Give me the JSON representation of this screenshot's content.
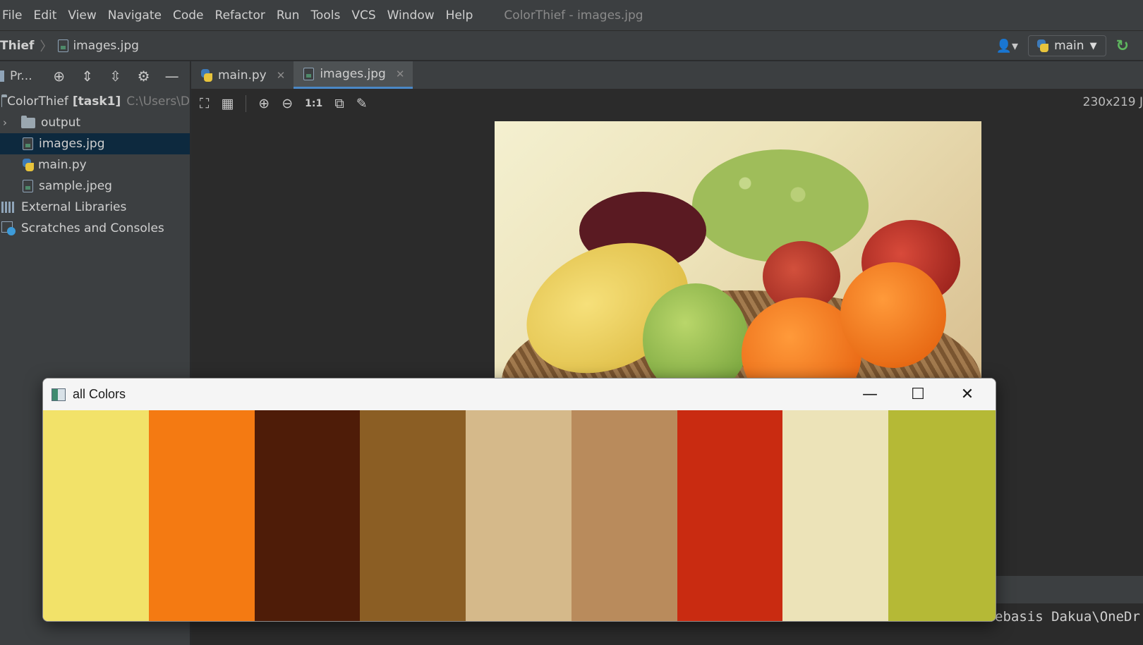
{
  "menu": {
    "items": [
      "File",
      "Edit",
      "View",
      "Navigate",
      "Code",
      "Refactor",
      "Run",
      "Tools",
      "VCS",
      "Window",
      "Help"
    ],
    "window_title": "ColorThief - images.jpg"
  },
  "navbar": {
    "project": "Thief",
    "file": "images.jpg",
    "run_config": "main"
  },
  "project_panel": {
    "title": "Pr...",
    "tree": [
      {
        "label": "ColorThief",
        "bold": "[task1]",
        "path": "C:\\Users\\D"
      },
      {
        "label": "output"
      },
      {
        "label": "images.jpg"
      },
      {
        "label": "main.py"
      },
      {
        "label": "sample.jpeg"
      },
      {
        "label": "External Libraries"
      },
      {
        "label": "Scratches and Consoles"
      }
    ]
  },
  "editor": {
    "tabs": [
      {
        "label": "main.py"
      },
      {
        "label": "images.jpg"
      }
    ],
    "image_info": "230x219 J",
    "zoom_actual_label": "1:1",
    "console_text": "ebasis Dakua\\OneDr"
  },
  "color_window": {
    "title": "all Colors",
    "swatches": [
      "#f2e269",
      "#f47a12",
      "#4e1c08",
      "#8b5e24",
      "#d5b98a",
      "#b98b5c",
      "#c92b11",
      "#ece3b8",
      "#b5b936"
    ]
  },
  "icons": {
    "user": "user-icon",
    "python": "python-icon",
    "reload": "reload-icon",
    "minimize": "minimize-icon",
    "maximize": "maximize-icon",
    "close": "close-icon"
  }
}
